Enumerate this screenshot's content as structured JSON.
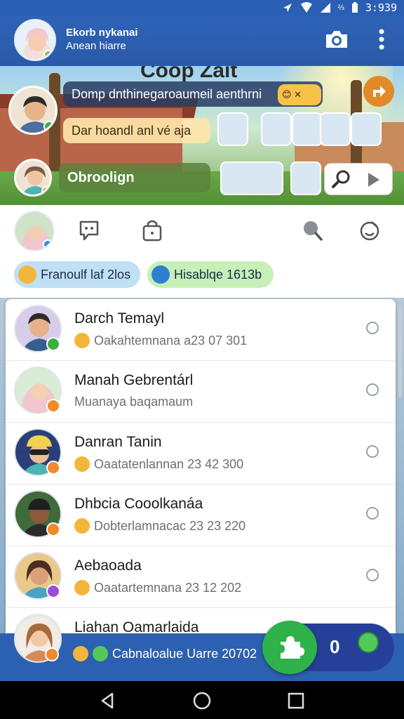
{
  "status_bar": {
    "time": "3:939"
  },
  "app_bar": {
    "title": "Ekorb nykanai",
    "subtitle": "Anean hiarre",
    "camera_icon": "camera-icon",
    "more_icon": "more-vertical-icon"
  },
  "hero": {
    "banner": "Coop Zait",
    "pill_1": "Domp dnthinegaroaumeil aenthrni",
    "pill_2": "Dar hoandl anl vé aja",
    "pill_3": "Obroolign",
    "badge_emoji": "😊 ✕"
  },
  "quick_bar": {
    "chip_1": "Franoulf laf 2los",
    "chip_2": "Hisablqe 1613b"
  },
  "contacts": [
    {
      "name": "Darch Temayl",
      "subtitle": "Oakahtemnana a23 07 301",
      "has_emoji": true,
      "badge_color": "#3fae3f"
    },
    {
      "name": "Manah Gebrentárl",
      "subtitle": "Muanaya baqamaum",
      "has_emoji": false,
      "badge_color": "#f08a2a"
    },
    {
      "name": "Danran Tanin",
      "subtitle": "Oaatatenlannan 23 42 300",
      "has_emoji": true,
      "badge_color": "#f08a2a"
    },
    {
      "name": "Dhbcia Cooolkanáa",
      "subtitle": "Dobterlamnacac 23 23 220",
      "has_emoji": true,
      "badge_color": "#f08a2a"
    },
    {
      "name": "Aebaoada",
      "subtitle": "Oaatartemnana 23 12 202",
      "has_emoji": true,
      "badge_color": "#9a4fd6"
    },
    {
      "name": "Liahan Oamarlaida",
      "subtitle": "Cabnaloalue Uarre 20702",
      "has_emoji": true,
      "badge_color": "#f08a2a"
    }
  ],
  "fab": {
    "count": "0"
  },
  "colors": {
    "primary": "#2b5fb3",
    "fab": "#2fb24a",
    "fab_group": "#26409a"
  }
}
